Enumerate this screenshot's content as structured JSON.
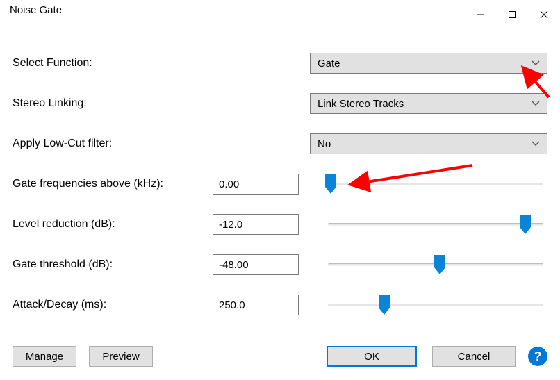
{
  "window": {
    "title": "Noise Gate"
  },
  "fields": {
    "select_function": {
      "label": "Select Function:",
      "value": "Gate"
    },
    "stereo_linking": {
      "label": "Stereo Linking:",
      "value": "Link Stereo Tracks"
    },
    "low_cut": {
      "label": "Apply Low-Cut filter:",
      "value": "No"
    },
    "gate_freq": {
      "label": "Gate frequencies above (kHz):",
      "value": "0.00",
      "slider_pct": 3
    },
    "level_reduction": {
      "label": "Level reduction (dB):",
      "value": "-12.0",
      "slider_pct": 90
    },
    "gate_threshold": {
      "label": "Gate threshold (dB):",
      "value": "-48.00",
      "slider_pct": 52
    },
    "attack_decay": {
      "label": "Attack/Decay (ms):",
      "value": "250.0",
      "slider_pct": 27
    }
  },
  "buttons": {
    "manage": "Manage",
    "preview": "Preview",
    "ok": "OK",
    "cancel": "Cancel",
    "help": "?"
  },
  "colors": {
    "slider_thumb": "#0a84d6",
    "accent_border": "#0078d7",
    "arrow": "#ff0000"
  }
}
